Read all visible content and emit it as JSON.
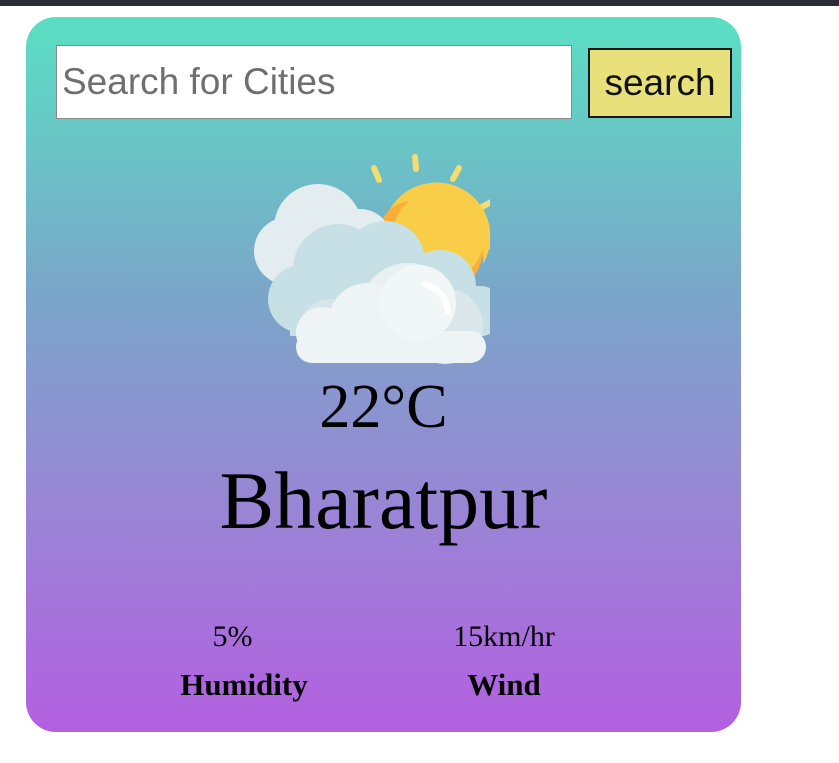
{
  "search": {
    "placeholder": "Search for Cities",
    "value": "",
    "button_label": "search"
  },
  "weather": {
    "icon": "partly-cloudy-icon",
    "temperature": "22°C",
    "city": "Bharatpur",
    "humidity_value": "5%",
    "humidity_label": "Humidity",
    "wind_value": "15km/hr",
    "wind_label": "Wind"
  },
  "colors": {
    "gradient_top": "#5adfc3",
    "gradient_bottom": "#b35fe0",
    "button_bg": "#e8e07a",
    "topbar": "#2b2e3a"
  }
}
